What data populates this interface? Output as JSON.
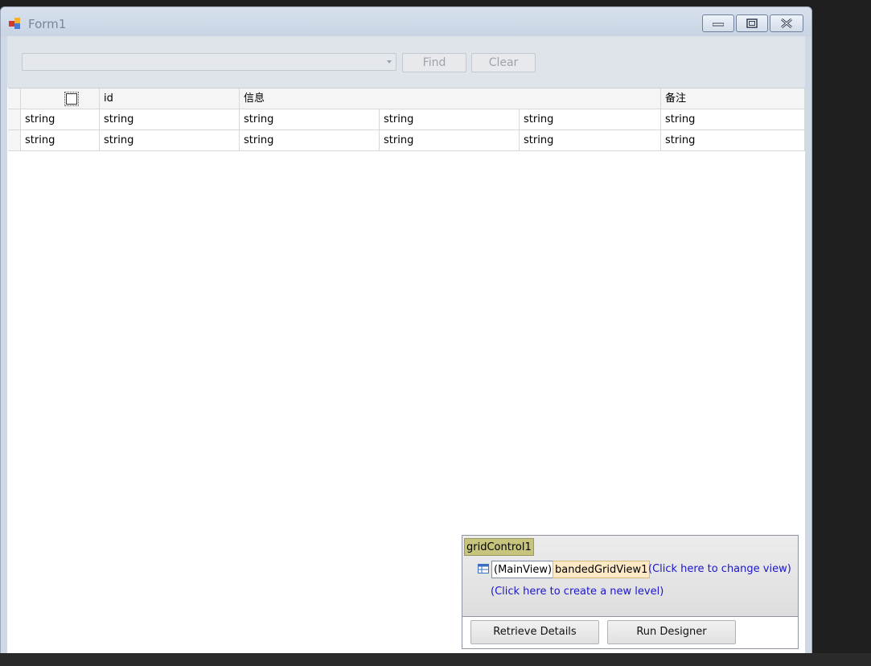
{
  "window": {
    "title": "Form1"
  },
  "toolbar": {
    "find_label": "Find",
    "clear_label": "Clear",
    "combo_value": ""
  },
  "grid": {
    "headers": [
      "",
      "id",
      "信息",
      "备注"
    ],
    "rows": [
      [
        "string",
        "string",
        "string",
        "string",
        "string",
        "string"
      ],
      [
        "string",
        "string",
        "string",
        "string",
        "string",
        "string"
      ]
    ]
  },
  "smart_panel": {
    "control_name": "gridControl1",
    "main_view_label": "(MainView)",
    "view_name": "bandedGridView1",
    "change_view_link": "(Click here to change view)",
    "create_level_link": "(Click here to create a new level)",
    "retrieve_label": "Retrieve Details",
    "designer_label": "Run Designer"
  },
  "colors": {
    "title_text": "#7a8696",
    "link": "#1c17c9",
    "control_tag_bg": "#c7c47d",
    "view_tag_bg": "#fde9c6"
  },
  "icons": [
    "app-icon",
    "minimize-icon",
    "restore-icon",
    "close-icon",
    "dropdown-arrow-icon",
    "grid-view-icon"
  ]
}
